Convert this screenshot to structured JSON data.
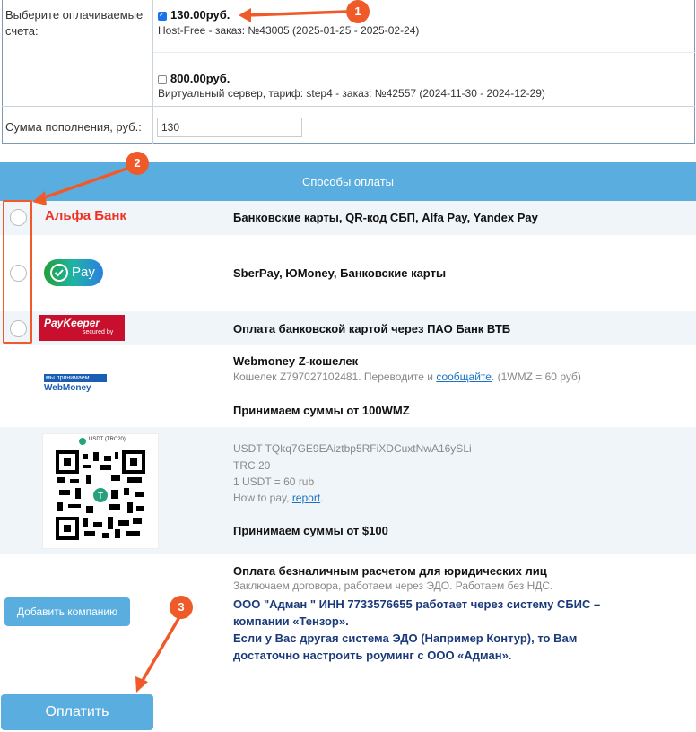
{
  "invoices": {
    "label": "Выберите оплачиваемые счета:",
    "items": [
      {
        "checked": true,
        "amount": "130.00руб.",
        "desc": "Host-Free - заказ: №43005 (2025-01-25 - 2025-02-24)"
      },
      {
        "checked": false,
        "amount": "800.00руб.",
        "desc": "Виртуальный сервер, тариф: step4 - заказ: №42557 (2024-11-30 - 2024-12-29)"
      }
    ],
    "sum_label": "Сумма пополнения, руб.:",
    "sum_value": "130"
  },
  "payment": {
    "header": "Способы оплаты",
    "methods": [
      {
        "logo": "Альфа Банк",
        "title": "Банковские карты, QR-код СБП, Alfa Pay, Yandex Pay"
      },
      {
        "logo": "Pay",
        "title": "SberPay, ЮMoney, Банковские карты"
      },
      {
        "logo": "PayKeeper",
        "logo_sub": "secured by",
        "title": "Оплата банковской картой через ПАО Банк ВТБ"
      }
    ],
    "webmoney": {
      "logo_top": "мы принимаем",
      "logo_bottom": "WebMoney",
      "title": "Webmoney Z-кошелек",
      "line_prefix": "Кошелек Z797027102481. Переводите и ",
      "link": "сообщайте",
      "line_suffix": ". (1WMZ = 60 руб)",
      "min": "Принимаем суммы от 100WMZ"
    },
    "usdt": {
      "qr_caption": "USDT (TRC20)",
      "address": "USDT TQkq7GE9EAiztbp5RFiXDCuxtNwA16ySLi",
      "network": "TRC 20",
      "rate": "1 USDT = 60 rub",
      "howto_prefix": "How to pay, ",
      "howto_link": "report",
      "howto_suffix": ".",
      "min": "Принимаем суммы от $100"
    },
    "legal": {
      "title": "Оплата безналичным расчетом для юридических лиц",
      "note": "Заключаем договора, работаем через ЭДО. Работаем без НДС.",
      "line1": "ООО \"Адман \" ИНН 7733576655 работает через систему СБИС –",
      "line2": "компании «Тензор».",
      "line3": "Если у Вас другая система ЭДО (Например Контур), то Вам",
      "line4": "достаточно настроить роуминг с ООО «Адман».",
      "add_company": "Добавить компанию"
    },
    "pay_button": "Оплатить"
  },
  "annotations": {
    "badge1": "1",
    "badge2": "2",
    "badge3": "3",
    "color": "#f05a28"
  }
}
